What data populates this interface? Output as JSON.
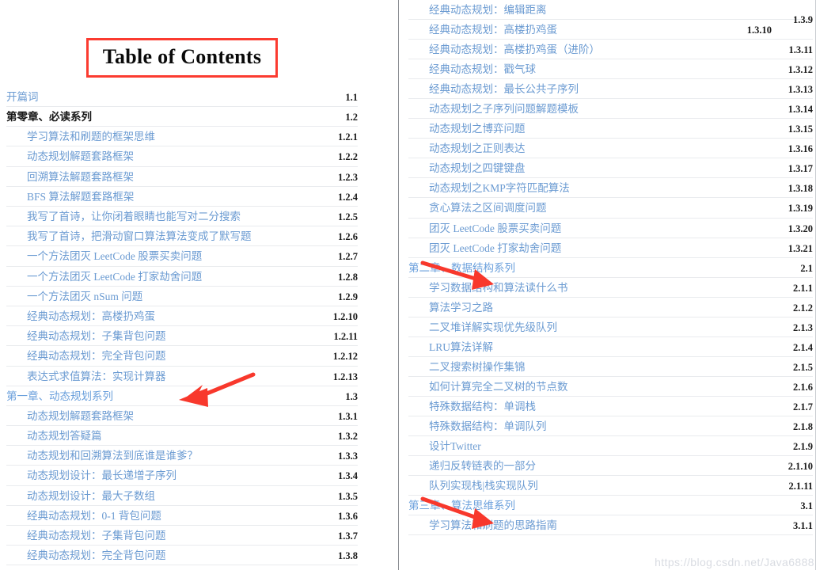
{
  "document": {
    "title": "Table of Contents",
    "accent_border_color": "#fb3b30",
    "link_color": "#6b9bd2",
    "heading_color": "#161616",
    "chapter_color": "#6ba0dc",
    "number_color": "#1a1a1a",
    "watermark": "https://blog.csdn.net/Java6888"
  },
  "left_column": {
    "rows": [
      {
        "label": "开篇词",
        "number": "1.1",
        "level": 1,
        "tone": "link"
      },
      {
        "label": "第零章、必读系列",
        "number": "1.2",
        "level": 1,
        "tone": "dark"
      },
      {
        "label": "学习算法和刷题的框架思维",
        "number": "1.2.1",
        "level": 2,
        "tone": "link"
      },
      {
        "label": "动态规划解题套路框架",
        "number": "1.2.2",
        "level": 2,
        "tone": "link"
      },
      {
        "label": "回溯算法解题套路框架",
        "number": "1.2.3",
        "level": 2,
        "tone": "link"
      },
      {
        "label": "BFS 算法解题套路框架",
        "number": "1.2.4",
        "level": 2,
        "tone": "link"
      },
      {
        "label": "我写了首诗，让你闭着眼睛也能写对二分搜索",
        "number": "1.2.5",
        "level": 2,
        "tone": "link"
      },
      {
        "label": "我写了首诗，把滑动窗口算法算法变成了默写题",
        "number": "1.2.6",
        "level": 2,
        "tone": "link"
      },
      {
        "label": "一个方法团灭 LeetCode 股票买卖问题",
        "number": "1.2.7",
        "level": 2,
        "tone": "link"
      },
      {
        "label": "一个方法团灭 LeetCode 打家劫舍问题",
        "number": "1.2.8",
        "level": 2,
        "tone": "link"
      },
      {
        "label": "一个方法团灭 nSum 问题",
        "number": "1.2.9",
        "level": 2,
        "tone": "link"
      },
      {
        "label": "经典动态规划：高楼扔鸡蛋",
        "number": "1.2.10",
        "level": 2,
        "tone": "link"
      },
      {
        "label": "经典动态规划：子集背包问题",
        "number": "1.2.11",
        "level": 2,
        "tone": "link"
      },
      {
        "label": "经典动态规划：完全背包问题",
        "number": "1.2.12",
        "level": 2,
        "tone": "link"
      },
      {
        "label": "表达式求值算法：实现计算器",
        "number": "1.2.13",
        "level": 2,
        "tone": "link"
      },
      {
        "label": "第一章、动态规划系列",
        "number": "1.3",
        "level": 1,
        "tone": "chap"
      },
      {
        "label": "动态规划解题套路框架",
        "number": "1.3.1",
        "level": 2,
        "tone": "link"
      },
      {
        "label": "动态规划答疑篇",
        "number": "1.3.2",
        "level": 2,
        "tone": "link"
      },
      {
        "label": "动态规划和回溯算法到底谁是谁爹？",
        "number": "1.3.3",
        "level": 2,
        "tone": "link"
      },
      {
        "label": "动态规划设计：最长递增子序列",
        "number": "1.3.4",
        "level": 2,
        "tone": "link"
      },
      {
        "label": "动态规划设计：最大子数组",
        "number": "1.3.5",
        "level": 2,
        "tone": "link"
      },
      {
        "label": "经典动态规划：0-1 背包问题",
        "number": "1.3.6",
        "level": 2,
        "tone": "link"
      },
      {
        "label": "经典动态规划：子集背包问题",
        "number": "1.3.7",
        "level": 2,
        "tone": "link"
      },
      {
        "label": "经典动态规划：完全背包问题",
        "number": "1.3.8",
        "level": 2,
        "tone": "link"
      }
    ]
  },
  "right_column": {
    "rows": [
      {
        "label": "经典动态规划：编辑距离",
        "number": "1.3.9",
        "level": 2,
        "tone": "link",
        "num_style": "shift-down"
      },
      {
        "label": "经典动态规划：高楼扔鸡蛋",
        "number": "1.3.10",
        "level": 2,
        "tone": "link",
        "num_style": "shift-left"
      },
      {
        "label": "经典动态规划：高楼扔鸡蛋（进阶）",
        "number": "1.3.11",
        "level": 2,
        "tone": "link"
      },
      {
        "label": "经典动态规划：戳气球",
        "number": "1.3.12",
        "level": 2,
        "tone": "link"
      },
      {
        "label": "经典动态规划：最长公共子序列",
        "number": "1.3.13",
        "level": 2,
        "tone": "link"
      },
      {
        "label": "动态规划之子序列问题解题模板",
        "number": "1.3.14",
        "level": 2,
        "tone": "link"
      },
      {
        "label": "动态规划之博弈问题",
        "number": "1.3.15",
        "level": 2,
        "tone": "link"
      },
      {
        "label": "动态规划之正则表达",
        "number": "1.3.16",
        "level": 2,
        "tone": "link"
      },
      {
        "label": "动态规划之四键键盘",
        "number": "1.3.17",
        "level": 2,
        "tone": "link"
      },
      {
        "label": "动态规划之KMP字符匹配算法",
        "number": "1.3.18",
        "level": 2,
        "tone": "link"
      },
      {
        "label": "贪心算法之区间调度问题",
        "number": "1.3.19",
        "level": 2,
        "tone": "link"
      },
      {
        "label": "团灭 LeetCode 股票买卖问题",
        "number": "1.3.20",
        "level": 2,
        "tone": "link"
      },
      {
        "label": "团灭 LeetCode 打家劫舍问题",
        "number": "1.3.21",
        "level": 2,
        "tone": "link"
      },
      {
        "label": "第二章、数据结构系列",
        "number": "2.1",
        "level": 1,
        "tone": "chap"
      },
      {
        "label": "学习数据结构和算法读什么书",
        "number": "2.1.1",
        "level": 2,
        "tone": "link"
      },
      {
        "label": "算法学习之路",
        "number": "2.1.2",
        "level": 2,
        "tone": "link"
      },
      {
        "label": "二叉堆详解实现优先级队列",
        "number": "2.1.3",
        "level": 2,
        "tone": "link"
      },
      {
        "label": "LRU算法详解",
        "number": "2.1.4",
        "level": 2,
        "tone": "link"
      },
      {
        "label": "二叉搜索树操作集锦",
        "number": "2.1.5",
        "level": 2,
        "tone": "link"
      },
      {
        "label": "如何计算完全二叉树的节点数",
        "number": "2.1.6",
        "level": 2,
        "tone": "link"
      },
      {
        "label": "特殊数据结构：单调栈",
        "number": "2.1.7",
        "level": 2,
        "tone": "link"
      },
      {
        "label": "特殊数据结构：单调队列",
        "number": "2.1.8",
        "level": 2,
        "tone": "link"
      },
      {
        "label": "设计Twitter",
        "number": "2.1.9",
        "level": 2,
        "tone": "link"
      },
      {
        "label": "递归反转链表的一部分",
        "number": "2.1.10",
        "level": 2,
        "tone": "link"
      },
      {
        "label": "队列实现栈|栈实现队列",
        "number": "2.1.11",
        "level": 2,
        "tone": "link"
      },
      {
        "label": "第三章、算法思维系列",
        "number": "3.1",
        "level": 1,
        "tone": "chap"
      },
      {
        "label": "学习算法和刷题的思路指南",
        "number": "3.1.1",
        "level": 2,
        "tone": "link"
      }
    ]
  },
  "annotations": {
    "arrows": [
      {
        "name": "arrow-to-chapter-one",
        "target": "第一章、动态规划系列",
        "color": "#f8382c"
      },
      {
        "name": "arrow-to-chapter-two",
        "target": "第二章、数据结构系列",
        "color": "#f8382c"
      },
      {
        "name": "arrow-to-chapter-three",
        "target": "第三章、算法思维系列",
        "color": "#f8382c"
      }
    ]
  }
}
